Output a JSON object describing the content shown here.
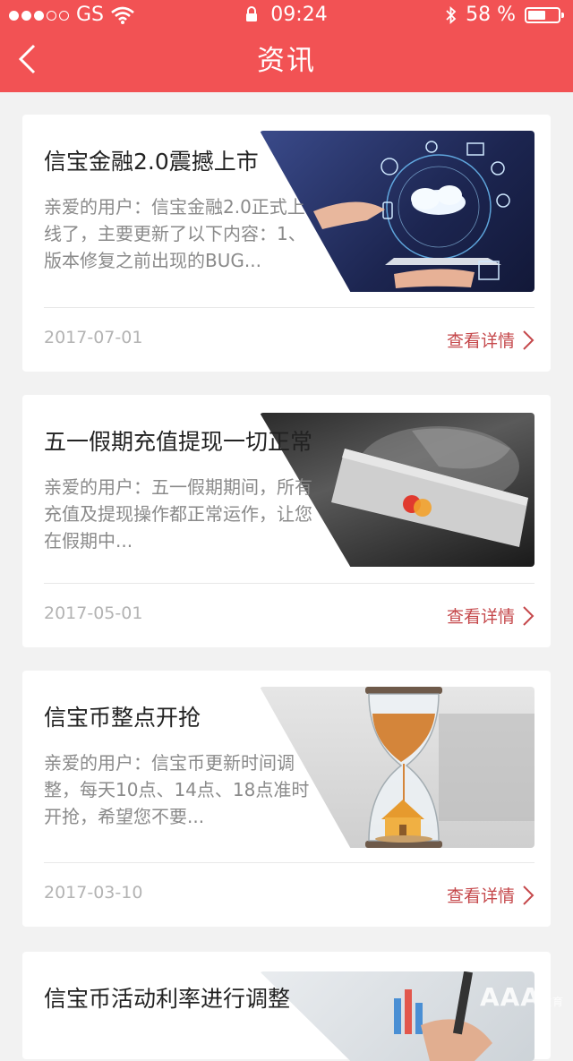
{
  "status_bar": {
    "carrier": "GS",
    "time": "09:24",
    "battery": "58 %",
    "battery_level": 0.58,
    "icons": [
      "signal-dots-icon",
      "wifi-icon",
      "lock-icon",
      "bluetooth-icon",
      "battery-icon"
    ]
  },
  "header": {
    "title": "资讯",
    "back_icon": "chevron-left-icon",
    "background": "#f25254"
  },
  "news": [
    {
      "headline": "信宝金融2.0震撼上市",
      "summary": "亲爱的用户：信宝金融2.0正式上线了，主要更新了以下内容：1、版本修复之前出现的BUG...",
      "date": "2017-07-01",
      "more": "查看详情",
      "image": "hand-holding-tablet-with-cloud-and-network-icons"
    },
    {
      "headline": "五一假期充值提现一切正常",
      "summary": "亲爱的用户：五一假期期间，所有充值及提现操作都正常运作，让您在假期中...",
      "date": "2017-05-01",
      "more": "查看详情",
      "image": "hand-holding-bank-card"
    },
    {
      "headline": "信宝币整点开抢",
      "summary": "亲爱的用户：信宝币更新时间调整，每天10点、14点、18点准时开抢，希望您不要...",
      "date": "2017-03-10",
      "more": "查看详情",
      "image": "hourglass-with-house"
    },
    {
      "headline": "信宝币活动利率进行调整",
      "image": "hand-with-pen-and-charts"
    }
  ],
  "watermark": {
    "text": "AAA",
    "sub": "教育"
  },
  "colors": {
    "accent": "#f25254",
    "link": "#c5484b",
    "date": "#b3b3b3",
    "summary": "#8a8a8a"
  }
}
